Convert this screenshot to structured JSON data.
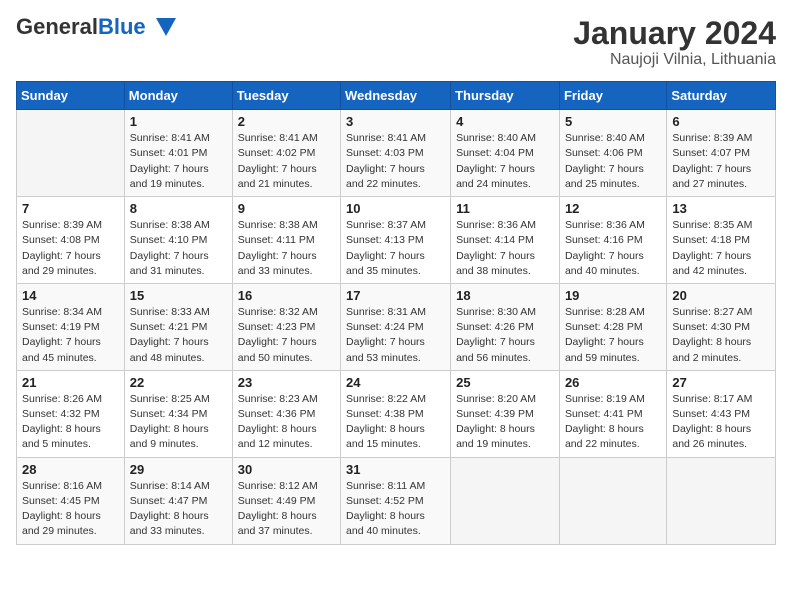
{
  "header": {
    "logo_general": "General",
    "logo_blue": "Blue",
    "month": "January 2024",
    "location": "Naujoji Vilnia, Lithuania"
  },
  "weekdays": [
    "Sunday",
    "Monday",
    "Tuesday",
    "Wednesday",
    "Thursday",
    "Friday",
    "Saturday"
  ],
  "weeks": [
    [
      {
        "day": "",
        "info": ""
      },
      {
        "day": "1",
        "info": "Sunrise: 8:41 AM\nSunset: 4:01 PM\nDaylight: 7 hours\nand 19 minutes."
      },
      {
        "day": "2",
        "info": "Sunrise: 8:41 AM\nSunset: 4:02 PM\nDaylight: 7 hours\nand 21 minutes."
      },
      {
        "day": "3",
        "info": "Sunrise: 8:41 AM\nSunset: 4:03 PM\nDaylight: 7 hours\nand 22 minutes."
      },
      {
        "day": "4",
        "info": "Sunrise: 8:40 AM\nSunset: 4:04 PM\nDaylight: 7 hours\nand 24 minutes."
      },
      {
        "day": "5",
        "info": "Sunrise: 8:40 AM\nSunset: 4:06 PM\nDaylight: 7 hours\nand 25 minutes."
      },
      {
        "day": "6",
        "info": "Sunrise: 8:39 AM\nSunset: 4:07 PM\nDaylight: 7 hours\nand 27 minutes."
      }
    ],
    [
      {
        "day": "7",
        "info": "Sunrise: 8:39 AM\nSunset: 4:08 PM\nDaylight: 7 hours\nand 29 minutes."
      },
      {
        "day": "8",
        "info": "Sunrise: 8:38 AM\nSunset: 4:10 PM\nDaylight: 7 hours\nand 31 minutes."
      },
      {
        "day": "9",
        "info": "Sunrise: 8:38 AM\nSunset: 4:11 PM\nDaylight: 7 hours\nand 33 minutes."
      },
      {
        "day": "10",
        "info": "Sunrise: 8:37 AM\nSunset: 4:13 PM\nDaylight: 7 hours\nand 35 minutes."
      },
      {
        "day": "11",
        "info": "Sunrise: 8:36 AM\nSunset: 4:14 PM\nDaylight: 7 hours\nand 38 minutes."
      },
      {
        "day": "12",
        "info": "Sunrise: 8:36 AM\nSunset: 4:16 PM\nDaylight: 7 hours\nand 40 minutes."
      },
      {
        "day": "13",
        "info": "Sunrise: 8:35 AM\nSunset: 4:18 PM\nDaylight: 7 hours\nand 42 minutes."
      }
    ],
    [
      {
        "day": "14",
        "info": "Sunrise: 8:34 AM\nSunset: 4:19 PM\nDaylight: 7 hours\nand 45 minutes."
      },
      {
        "day": "15",
        "info": "Sunrise: 8:33 AM\nSunset: 4:21 PM\nDaylight: 7 hours\nand 48 minutes."
      },
      {
        "day": "16",
        "info": "Sunrise: 8:32 AM\nSunset: 4:23 PM\nDaylight: 7 hours\nand 50 minutes."
      },
      {
        "day": "17",
        "info": "Sunrise: 8:31 AM\nSunset: 4:24 PM\nDaylight: 7 hours\nand 53 minutes."
      },
      {
        "day": "18",
        "info": "Sunrise: 8:30 AM\nSunset: 4:26 PM\nDaylight: 7 hours\nand 56 minutes."
      },
      {
        "day": "19",
        "info": "Sunrise: 8:28 AM\nSunset: 4:28 PM\nDaylight: 7 hours\nand 59 minutes."
      },
      {
        "day": "20",
        "info": "Sunrise: 8:27 AM\nSunset: 4:30 PM\nDaylight: 8 hours\nand 2 minutes."
      }
    ],
    [
      {
        "day": "21",
        "info": "Sunrise: 8:26 AM\nSunset: 4:32 PM\nDaylight: 8 hours\nand 5 minutes."
      },
      {
        "day": "22",
        "info": "Sunrise: 8:25 AM\nSunset: 4:34 PM\nDaylight: 8 hours\nand 9 minutes."
      },
      {
        "day": "23",
        "info": "Sunrise: 8:23 AM\nSunset: 4:36 PM\nDaylight: 8 hours\nand 12 minutes."
      },
      {
        "day": "24",
        "info": "Sunrise: 8:22 AM\nSunset: 4:38 PM\nDaylight: 8 hours\nand 15 minutes."
      },
      {
        "day": "25",
        "info": "Sunrise: 8:20 AM\nSunset: 4:39 PM\nDaylight: 8 hours\nand 19 minutes."
      },
      {
        "day": "26",
        "info": "Sunrise: 8:19 AM\nSunset: 4:41 PM\nDaylight: 8 hours\nand 22 minutes."
      },
      {
        "day": "27",
        "info": "Sunrise: 8:17 AM\nSunset: 4:43 PM\nDaylight: 8 hours\nand 26 minutes."
      }
    ],
    [
      {
        "day": "28",
        "info": "Sunrise: 8:16 AM\nSunset: 4:45 PM\nDaylight: 8 hours\nand 29 minutes."
      },
      {
        "day": "29",
        "info": "Sunrise: 8:14 AM\nSunset: 4:47 PM\nDaylight: 8 hours\nand 33 minutes."
      },
      {
        "day": "30",
        "info": "Sunrise: 8:12 AM\nSunset: 4:49 PM\nDaylight: 8 hours\nand 37 minutes."
      },
      {
        "day": "31",
        "info": "Sunrise: 8:11 AM\nSunset: 4:52 PM\nDaylight: 8 hours\nand 40 minutes."
      },
      {
        "day": "",
        "info": ""
      },
      {
        "day": "",
        "info": ""
      },
      {
        "day": "",
        "info": ""
      }
    ]
  ]
}
